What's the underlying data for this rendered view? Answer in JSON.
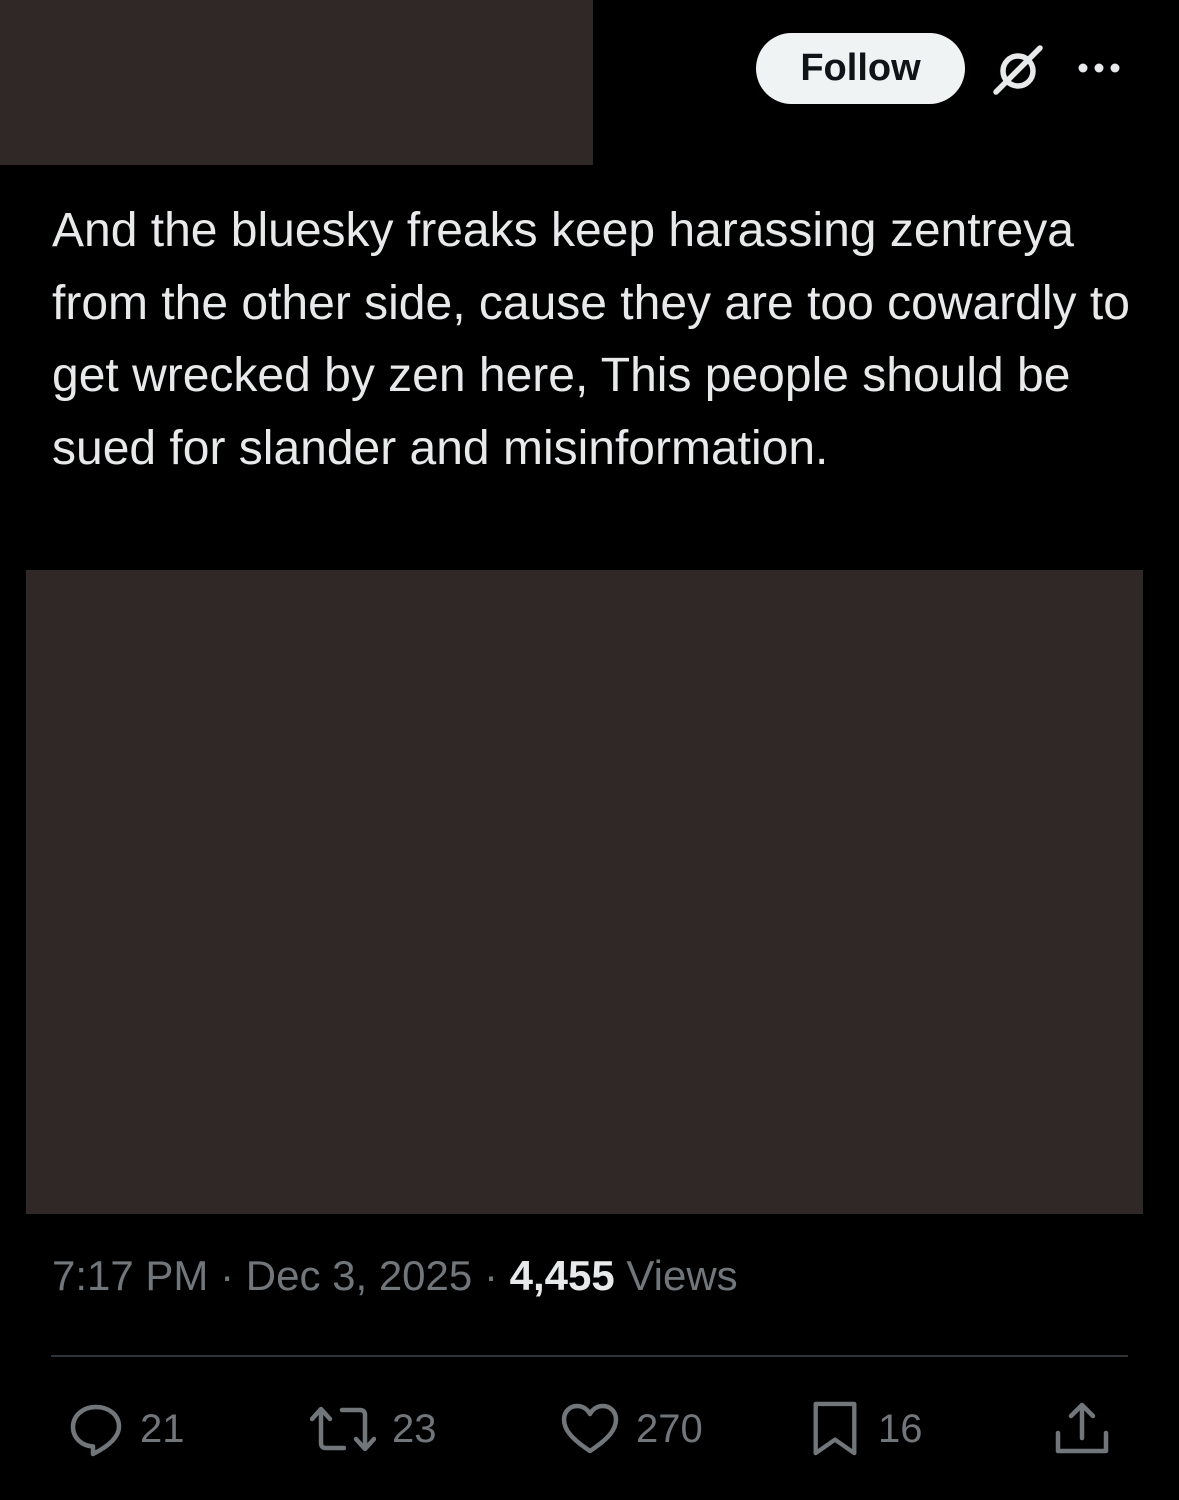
{
  "header": {
    "follow_label": "Follow",
    "icons": [
      "grok-icon",
      "more-icon"
    ]
  },
  "tweet": {
    "text": "And the bluesky freaks keep harassing zentreya from the other side, cause they are too cowardly to get wrecked by zen here, This people should be sued for slander and misinformation."
  },
  "meta": {
    "time": "7:17 PM",
    "separator": "·",
    "date": "Dec 3, 2025",
    "views_count": "4,455",
    "views_label": "Views"
  },
  "actions": {
    "reply_count": "21",
    "repost_count": "23",
    "like_count": "270",
    "bookmark_count": "16"
  },
  "colors": {
    "background": "#000000",
    "text": "#e7e9ea",
    "muted": "#71767b",
    "redacted_block": "#302727",
    "follow_button_bg": "#eff3f4"
  }
}
